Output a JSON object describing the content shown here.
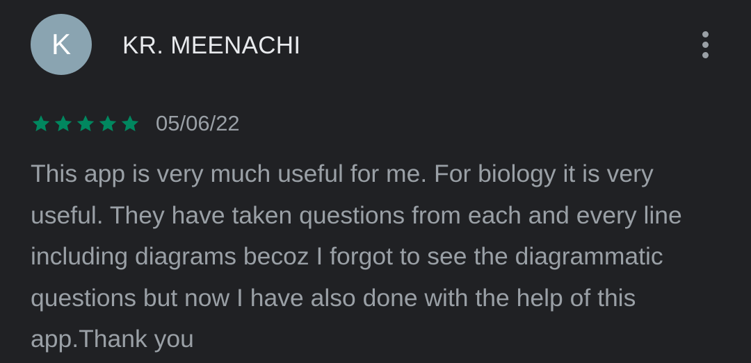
{
  "review": {
    "avatar_letter": "K",
    "reviewer_name": "KR. MEENACHI",
    "menu_icon": "more-vert-icon",
    "rating": 5,
    "rating_max": 5,
    "star_color": "#01875f",
    "date": "05/06/22",
    "text": "This app is very much useful for me. For biology it is very useful. They have taken questions from each and every line including diagrams becoz I forgot to see the diagrammatic questions but now I have also done with the help of this app.Thank you"
  }
}
